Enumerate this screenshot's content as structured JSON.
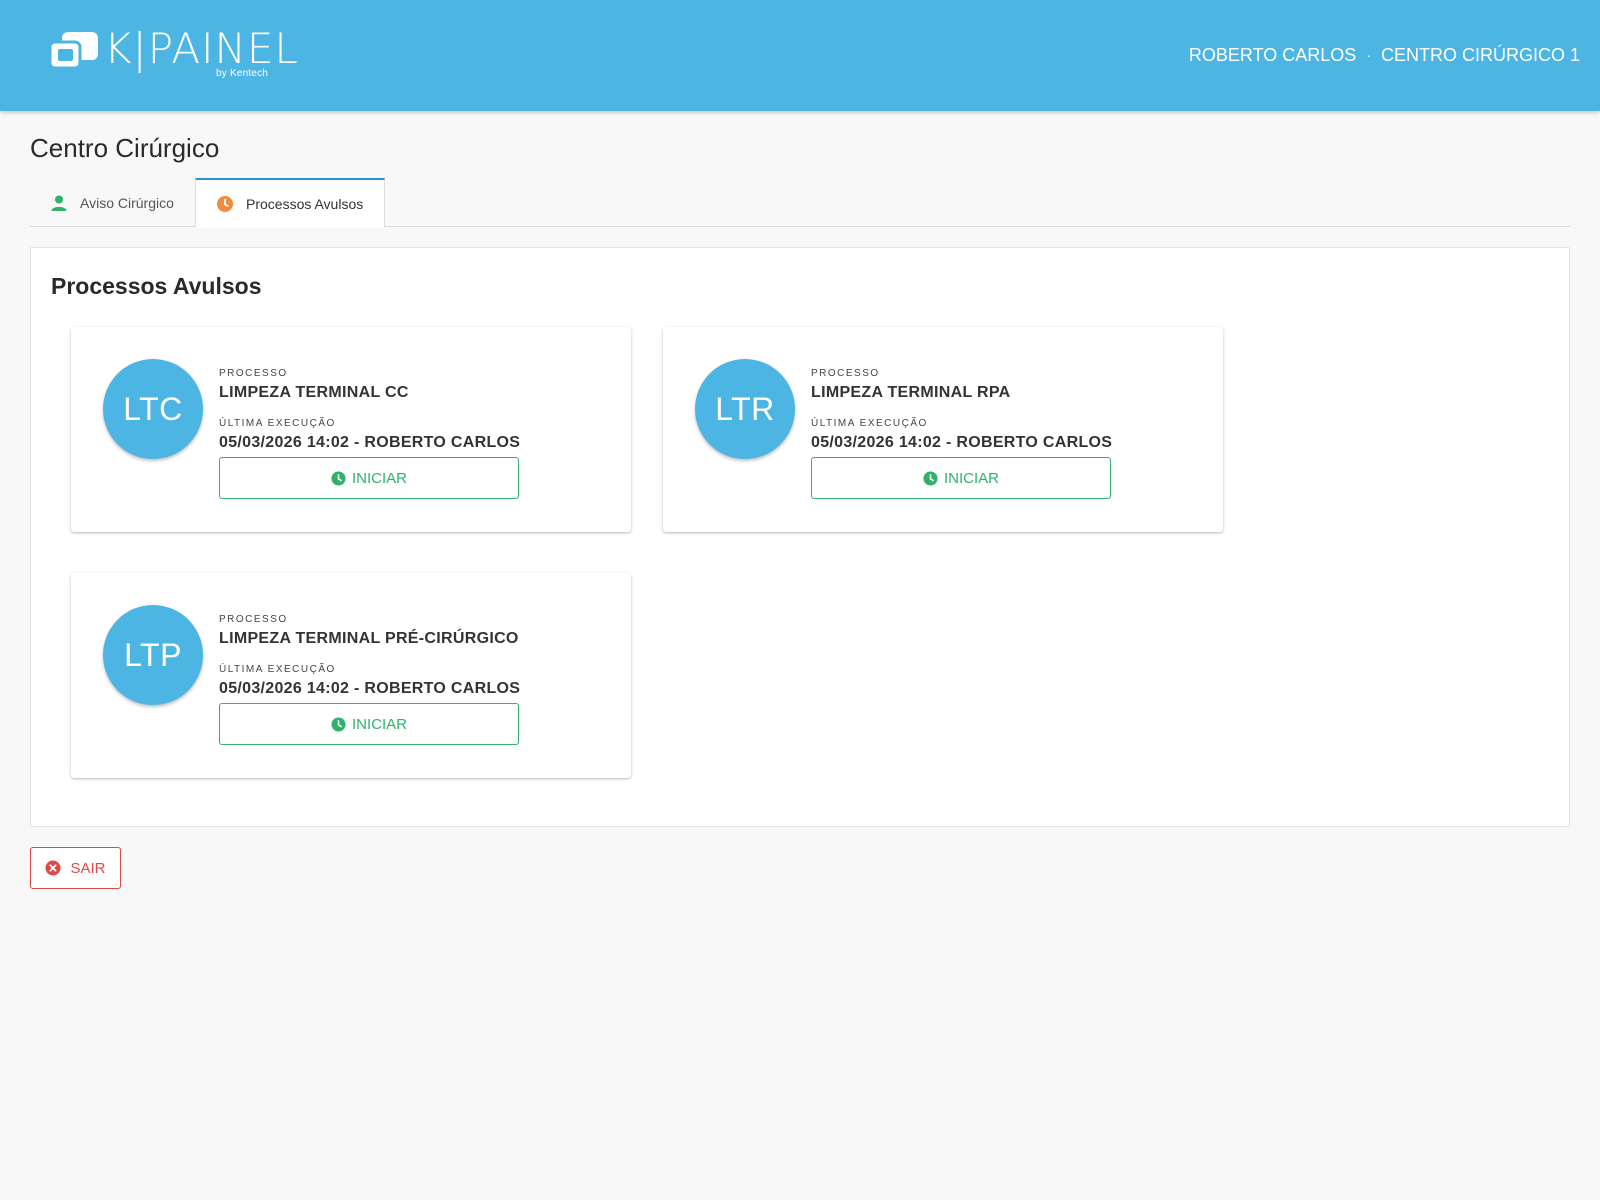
{
  "header": {
    "logo_text": "K|PAINEL",
    "logo_sub": "by Kentech",
    "user_name": "ROBERTO CARLOS",
    "separator": "·",
    "location": "CENTRO CIRÚRGICO 1"
  },
  "page": {
    "title": "Centro Cirúrgico"
  },
  "tabs": [
    {
      "label": "Aviso Cirúrgico",
      "icon": "user-icon",
      "active": false
    },
    {
      "label": "Processos Avulsos",
      "icon": "clock-icon",
      "active": true
    }
  ],
  "panel": {
    "title": "Processos Avulsos",
    "cards": [
      {
        "initials": "LTC",
        "process_label": "PROCESSO",
        "process_name": "LIMPEZA TERMINAL CC",
        "last_exec_label": "ÚLTIMA EXECUÇÃO",
        "last_exec_value": "05/03/2026 14:02 - ROBERTO CARLOS",
        "button_label": "INICIAR"
      },
      {
        "initials": "LTR",
        "process_label": "PROCESSO",
        "process_name": "LIMPEZA TERMINAL RPA",
        "last_exec_label": "ÚLTIMA EXECUÇÃO",
        "last_exec_value": "05/03/2026 14:02 - ROBERTO CARLOS",
        "button_label": "INICIAR"
      },
      {
        "initials": "LTP",
        "process_label": "PROCESSO",
        "process_name": "LIMPEZA TERMINAL PRÉ-CIRÚRGICO",
        "last_exec_label": "ÚLTIMA EXECUÇÃO",
        "last_exec_value": "05/03/2026 14:02 - ROBERTO CARLOS",
        "button_label": "INICIAR"
      }
    ]
  },
  "footer": {
    "exit_label": "SAIR",
    "exit_icon": "close-circle-icon"
  },
  "colors": {
    "header_bg": "#4db5e3",
    "avatar_bg": "#4db5e3",
    "start_green": "#2db36a",
    "exit_red": "#e04848",
    "tab_active_border": "#2c90d8",
    "user_icon": "#2db36a",
    "clock_icon_tab": "#f08a3c"
  }
}
